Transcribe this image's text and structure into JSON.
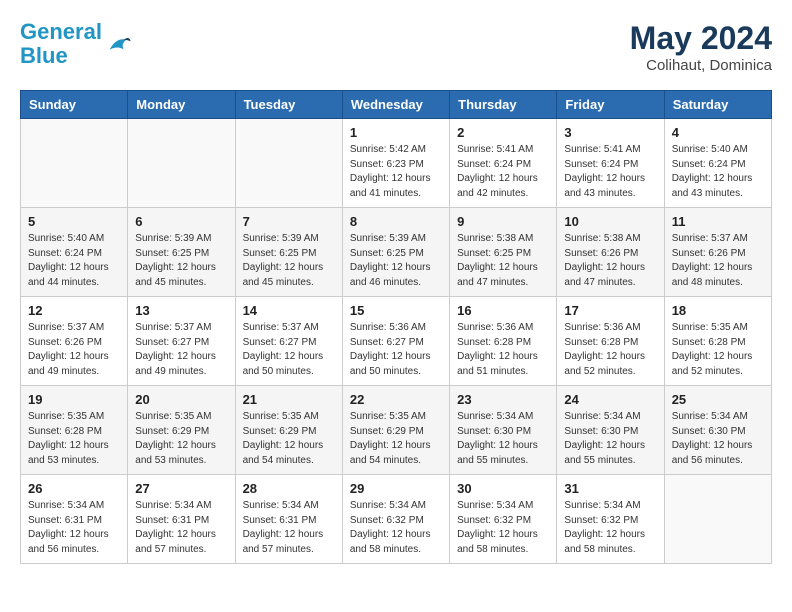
{
  "header": {
    "logo_line1": "General",
    "logo_line2": "Blue",
    "month_year": "May 2024",
    "location": "Colihaut, Dominica"
  },
  "weekdays": [
    "Sunday",
    "Monday",
    "Tuesday",
    "Wednesday",
    "Thursday",
    "Friday",
    "Saturday"
  ],
  "weeks": [
    [
      {
        "day": "",
        "info": ""
      },
      {
        "day": "",
        "info": ""
      },
      {
        "day": "",
        "info": ""
      },
      {
        "day": "1",
        "info": "Sunrise: 5:42 AM\nSunset: 6:23 PM\nDaylight: 12 hours\nand 41 minutes."
      },
      {
        "day": "2",
        "info": "Sunrise: 5:41 AM\nSunset: 6:24 PM\nDaylight: 12 hours\nand 42 minutes."
      },
      {
        "day": "3",
        "info": "Sunrise: 5:41 AM\nSunset: 6:24 PM\nDaylight: 12 hours\nand 43 minutes."
      },
      {
        "day": "4",
        "info": "Sunrise: 5:40 AM\nSunset: 6:24 PM\nDaylight: 12 hours\nand 43 minutes."
      }
    ],
    [
      {
        "day": "5",
        "info": "Sunrise: 5:40 AM\nSunset: 6:24 PM\nDaylight: 12 hours\nand 44 minutes."
      },
      {
        "day": "6",
        "info": "Sunrise: 5:39 AM\nSunset: 6:25 PM\nDaylight: 12 hours\nand 45 minutes."
      },
      {
        "day": "7",
        "info": "Sunrise: 5:39 AM\nSunset: 6:25 PM\nDaylight: 12 hours\nand 45 minutes."
      },
      {
        "day": "8",
        "info": "Sunrise: 5:39 AM\nSunset: 6:25 PM\nDaylight: 12 hours\nand 46 minutes."
      },
      {
        "day": "9",
        "info": "Sunrise: 5:38 AM\nSunset: 6:25 PM\nDaylight: 12 hours\nand 47 minutes."
      },
      {
        "day": "10",
        "info": "Sunrise: 5:38 AM\nSunset: 6:26 PM\nDaylight: 12 hours\nand 47 minutes."
      },
      {
        "day": "11",
        "info": "Sunrise: 5:37 AM\nSunset: 6:26 PM\nDaylight: 12 hours\nand 48 minutes."
      }
    ],
    [
      {
        "day": "12",
        "info": "Sunrise: 5:37 AM\nSunset: 6:26 PM\nDaylight: 12 hours\nand 49 minutes."
      },
      {
        "day": "13",
        "info": "Sunrise: 5:37 AM\nSunset: 6:27 PM\nDaylight: 12 hours\nand 49 minutes."
      },
      {
        "day": "14",
        "info": "Sunrise: 5:37 AM\nSunset: 6:27 PM\nDaylight: 12 hours\nand 50 minutes."
      },
      {
        "day": "15",
        "info": "Sunrise: 5:36 AM\nSunset: 6:27 PM\nDaylight: 12 hours\nand 50 minutes."
      },
      {
        "day": "16",
        "info": "Sunrise: 5:36 AM\nSunset: 6:28 PM\nDaylight: 12 hours\nand 51 minutes."
      },
      {
        "day": "17",
        "info": "Sunrise: 5:36 AM\nSunset: 6:28 PM\nDaylight: 12 hours\nand 52 minutes."
      },
      {
        "day": "18",
        "info": "Sunrise: 5:35 AM\nSunset: 6:28 PM\nDaylight: 12 hours\nand 52 minutes."
      }
    ],
    [
      {
        "day": "19",
        "info": "Sunrise: 5:35 AM\nSunset: 6:28 PM\nDaylight: 12 hours\nand 53 minutes."
      },
      {
        "day": "20",
        "info": "Sunrise: 5:35 AM\nSunset: 6:29 PM\nDaylight: 12 hours\nand 53 minutes."
      },
      {
        "day": "21",
        "info": "Sunrise: 5:35 AM\nSunset: 6:29 PM\nDaylight: 12 hours\nand 54 minutes."
      },
      {
        "day": "22",
        "info": "Sunrise: 5:35 AM\nSunset: 6:29 PM\nDaylight: 12 hours\nand 54 minutes."
      },
      {
        "day": "23",
        "info": "Sunrise: 5:34 AM\nSunset: 6:30 PM\nDaylight: 12 hours\nand 55 minutes."
      },
      {
        "day": "24",
        "info": "Sunrise: 5:34 AM\nSunset: 6:30 PM\nDaylight: 12 hours\nand 55 minutes."
      },
      {
        "day": "25",
        "info": "Sunrise: 5:34 AM\nSunset: 6:30 PM\nDaylight: 12 hours\nand 56 minutes."
      }
    ],
    [
      {
        "day": "26",
        "info": "Sunrise: 5:34 AM\nSunset: 6:31 PM\nDaylight: 12 hours\nand 56 minutes."
      },
      {
        "day": "27",
        "info": "Sunrise: 5:34 AM\nSunset: 6:31 PM\nDaylight: 12 hours\nand 57 minutes."
      },
      {
        "day": "28",
        "info": "Sunrise: 5:34 AM\nSunset: 6:31 PM\nDaylight: 12 hours\nand 57 minutes."
      },
      {
        "day": "29",
        "info": "Sunrise: 5:34 AM\nSunset: 6:32 PM\nDaylight: 12 hours\nand 58 minutes."
      },
      {
        "day": "30",
        "info": "Sunrise: 5:34 AM\nSunset: 6:32 PM\nDaylight: 12 hours\nand 58 minutes."
      },
      {
        "day": "31",
        "info": "Sunrise: 5:34 AM\nSunset: 6:32 PM\nDaylight: 12 hours\nand 58 minutes."
      },
      {
        "day": "",
        "info": ""
      }
    ]
  ]
}
